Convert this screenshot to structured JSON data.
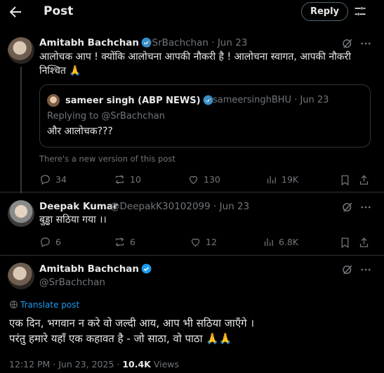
{
  "header": {
    "title": "Post",
    "reply_label": "Reply"
  },
  "icons": {
    "back": "arrow-left-icon",
    "tune": "sliders-icon",
    "grok": "grok-icon",
    "more": "more-icon"
  },
  "colors": {
    "background": "#000000",
    "text": "#e7e9ea",
    "muted": "#71767b",
    "verified": "#1d9bf0",
    "link": "#1d9bf0"
  },
  "post1": {
    "author": "Amitabh Bachchan",
    "handle_time": "@SrBachchan · Jun 23",
    "text_line1": "आलोचक आप ! क्योंकि आलोचना आपकी नौकरी है ! आलोचना स्वागत, आपकी नौकरी",
    "text_line2": "निश्चित 🙏",
    "quote": {
      "author": "sameer singh (ABP NEWS)",
      "handle_time": "@sameersinghBHU · Jun 23",
      "replying": "Replying to @SrBachchan",
      "text": "और आलोचक???"
    },
    "notice": "There's a new version of this post",
    "actions": {
      "replies": "34",
      "reposts": "10",
      "likes": "130",
      "views": "19K"
    }
  },
  "post2": {
    "author": "Deepak Kumar",
    "handle_time": "@DeepakK30102099 · Jun 23",
    "text": "बुड्ढा सठिया गया ।।",
    "actions": {
      "replies": "6",
      "reposts": "6",
      "likes": "12",
      "views": "6.8K"
    }
  },
  "main": {
    "author": "Amitabh Bachchan",
    "handle": "@SrBachchan",
    "translate": "Translate post",
    "text_line1": "एक दिन, भगवान न करे वो जल्दी आय, आप भी सठिया जाएँगे  ।",
    "text_line2": "परंतु हमारे यहाँ एक कहावत है  - जो साठा, वो पाठा 🙏🙏",
    "time": "12:12 PM · Jun 23, 2025 · ",
    "views_count": "10.4K",
    "views_label": " Views"
  }
}
